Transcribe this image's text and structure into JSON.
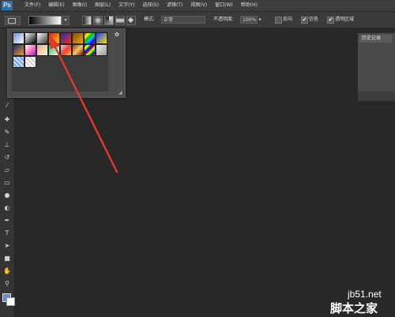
{
  "app": {
    "logo": "Ps"
  },
  "menu": {
    "items": [
      {
        "label": "文件(F)"
      },
      {
        "label": "编辑(E)"
      },
      {
        "label": "图像(I)"
      },
      {
        "label": "图层(L)"
      },
      {
        "label": "文字(Y)"
      },
      {
        "label": "选择(S)"
      },
      {
        "label": "滤镜(T)"
      },
      {
        "label": "视图(V)"
      },
      {
        "label": "窗口(W)"
      },
      {
        "label": "帮助(H)"
      }
    ]
  },
  "options": {
    "gradient_dropdown_arrow": "▾",
    "mode_label": "模式:",
    "mode_value": "正常",
    "opacity_label": "不透明度:",
    "opacity_value": "100%",
    "opacity_arrow": "▸",
    "reverse_label": "反向",
    "dither_label": "仿色",
    "transparency_label": "透明区域",
    "reverse_checked": false,
    "dither_checked": true,
    "transparency_checked": true,
    "check_mark": "✔"
  },
  "gradient_picker": {
    "gear_icon": "✿",
    "resize_icon": "◢",
    "swatches": [
      "linear-gradient(135deg,#6f8fd0,#ffffff)",
      "linear-gradient(135deg,#ffffff,#000000)",
      "linear-gradient(135deg,#ffffff,rgba(255,255,255,0))",
      "linear-gradient(135deg,#d42020,#f7d000)",
      "linear-gradient(135deg,#1a2fbd,#ff2d00)",
      "linear-gradient(135deg,#7a4a1a,#f7a800)",
      "linear-gradient(135deg,#ff0000,#ffff00,#00c000,#00c0ff,#0000ff,#ff00ff)",
      "linear-gradient(135deg,#1a3cff,#ffe000)",
      "linear-gradient(135deg,#0e2b8b,#ff9a00)",
      "linear-gradient(135deg,#ffffff,#ff7ac0,#8a2be2)",
      "linear-gradient(135deg,#b6b6b6,#ffd0a0,#ffffff)",
      "linear-gradient(135deg,#2bb24c,#ffffff)",
      "linear-gradient(135deg,#dcdcdc,#ff3b3b,#ffcc00)",
      "linear-gradient(135deg,#8a3a1a,#ffc06a,#4a1a0a)",
      "repeating-linear-gradient(135deg,#ff0000 0 2px,#ffff00 2px 4px,#00ff00 4px 6px,#0000ff 6px 8px)",
      "linear-gradient(135deg,#f0f0f0,#9a9a9a)",
      "repeating-linear-gradient(45deg,#e0e0e0 0 2px,#6aa0ff 2px 4px)",
      "repeating-linear-gradient(45deg,#d0d0d0 0 2px,#ffffff 2px 4px)"
    ]
  },
  "history": {
    "tab_label": "历史记录"
  },
  "watermark": {
    "url": "jb51.net",
    "site_name": "脚本之家"
  },
  "colors": {
    "canvas_bg": "#282828",
    "panel_bg": "#4b4b4b",
    "arrow": "#e0392e",
    "foreground": "#6a8cc0",
    "background": "#ffffff"
  }
}
